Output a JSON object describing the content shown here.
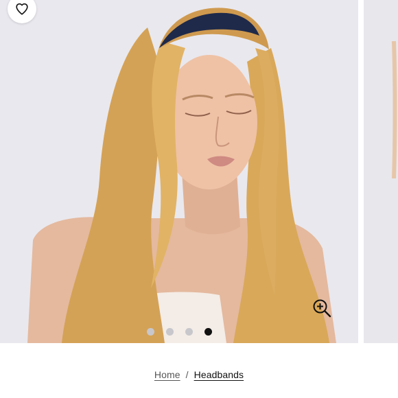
{
  "gallery": {
    "slide_count": 4,
    "active_slide": 4,
    "wishlist_icon": "heart-icon",
    "zoom_icon": "zoom-in-icon"
  },
  "breadcrumb": {
    "home": "Home",
    "separator": "/",
    "current": "Headbands"
  }
}
